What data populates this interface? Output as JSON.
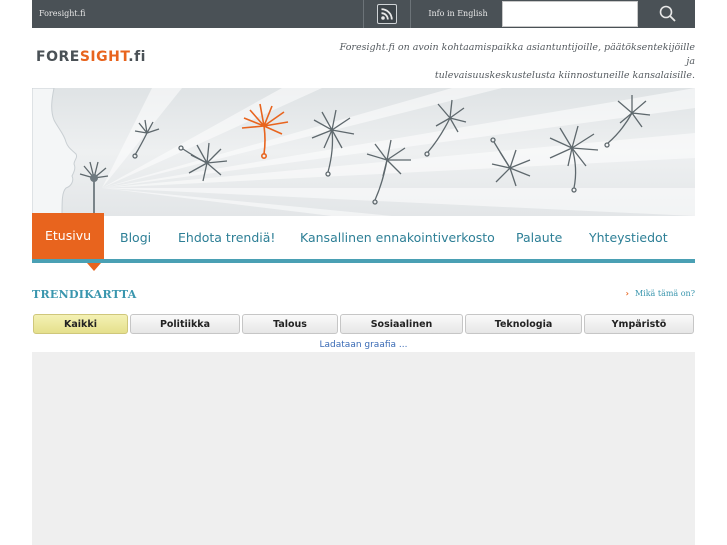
{
  "topbar": {
    "site_name": "Foresight.fi",
    "rss_icon": "rss-icon",
    "info_label": "Info in English",
    "search_value": "",
    "search_icon": "search-icon"
  },
  "header": {
    "logo_fore": "FORE",
    "logo_sight": "SIGHT",
    "logo_tld": ".fi",
    "tagline_line1": "Foresight.fi on avoin kohtaamispaikka asiantuntijoille, päätöksentekijöille ja",
    "tagline_line2": "tulevaisuuskeskustelusta kiinnostuneille kansalaisille."
  },
  "nav": {
    "items": [
      {
        "label": "Etusivu"
      },
      {
        "label": "Blogi"
      },
      {
        "label": "Ehdota trendiä!"
      },
      {
        "label": "Kansallinen ennakointiverkosto"
      },
      {
        "label": "Palaute"
      },
      {
        "label": "Yhteystiedot"
      }
    ]
  },
  "trend": {
    "title": "TRENDIKARTTA",
    "what_is_label": "Mikä tämä on?",
    "tabs": [
      "Kaikki",
      "Politiikka",
      "Talous",
      "Sosiaalinen",
      "Teknologia",
      "Ympäristö"
    ],
    "loading_text": "Ladataan graafia ..."
  },
  "colors": {
    "accent_orange": "#e8641e",
    "accent_teal": "#3a96ae",
    "topbar_bg": "#4a5156",
    "active_tab": "#ece7a0"
  }
}
